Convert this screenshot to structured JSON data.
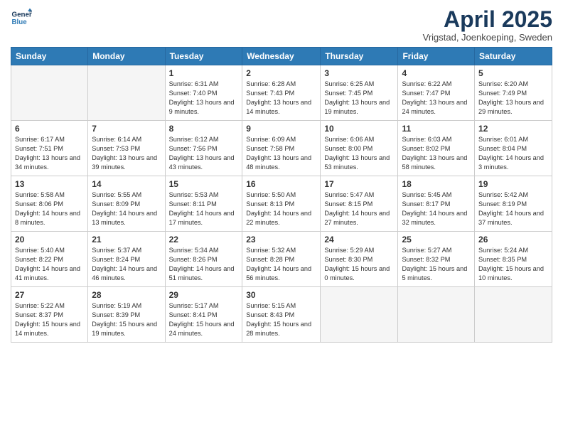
{
  "header": {
    "logo_line1": "General",
    "logo_line2": "Blue",
    "title": "April 2025",
    "location": "Vrigstad, Joenkoeping, Sweden"
  },
  "weekdays": [
    "Sunday",
    "Monday",
    "Tuesday",
    "Wednesday",
    "Thursday",
    "Friday",
    "Saturday"
  ],
  "weeks": [
    [
      {
        "day": "",
        "info": ""
      },
      {
        "day": "",
        "info": ""
      },
      {
        "day": "1",
        "info": "Sunrise: 6:31 AM\nSunset: 7:40 PM\nDaylight: 13 hours and 9 minutes."
      },
      {
        "day": "2",
        "info": "Sunrise: 6:28 AM\nSunset: 7:43 PM\nDaylight: 13 hours and 14 minutes."
      },
      {
        "day": "3",
        "info": "Sunrise: 6:25 AM\nSunset: 7:45 PM\nDaylight: 13 hours and 19 minutes."
      },
      {
        "day": "4",
        "info": "Sunrise: 6:22 AM\nSunset: 7:47 PM\nDaylight: 13 hours and 24 minutes."
      },
      {
        "day": "5",
        "info": "Sunrise: 6:20 AM\nSunset: 7:49 PM\nDaylight: 13 hours and 29 minutes."
      }
    ],
    [
      {
        "day": "6",
        "info": "Sunrise: 6:17 AM\nSunset: 7:51 PM\nDaylight: 13 hours and 34 minutes."
      },
      {
        "day": "7",
        "info": "Sunrise: 6:14 AM\nSunset: 7:53 PM\nDaylight: 13 hours and 39 minutes."
      },
      {
        "day": "8",
        "info": "Sunrise: 6:12 AM\nSunset: 7:56 PM\nDaylight: 13 hours and 43 minutes."
      },
      {
        "day": "9",
        "info": "Sunrise: 6:09 AM\nSunset: 7:58 PM\nDaylight: 13 hours and 48 minutes."
      },
      {
        "day": "10",
        "info": "Sunrise: 6:06 AM\nSunset: 8:00 PM\nDaylight: 13 hours and 53 minutes."
      },
      {
        "day": "11",
        "info": "Sunrise: 6:03 AM\nSunset: 8:02 PM\nDaylight: 13 hours and 58 minutes."
      },
      {
        "day": "12",
        "info": "Sunrise: 6:01 AM\nSunset: 8:04 PM\nDaylight: 14 hours and 3 minutes."
      }
    ],
    [
      {
        "day": "13",
        "info": "Sunrise: 5:58 AM\nSunset: 8:06 PM\nDaylight: 14 hours and 8 minutes."
      },
      {
        "day": "14",
        "info": "Sunrise: 5:55 AM\nSunset: 8:09 PM\nDaylight: 14 hours and 13 minutes."
      },
      {
        "day": "15",
        "info": "Sunrise: 5:53 AM\nSunset: 8:11 PM\nDaylight: 14 hours and 17 minutes."
      },
      {
        "day": "16",
        "info": "Sunrise: 5:50 AM\nSunset: 8:13 PM\nDaylight: 14 hours and 22 minutes."
      },
      {
        "day": "17",
        "info": "Sunrise: 5:47 AM\nSunset: 8:15 PM\nDaylight: 14 hours and 27 minutes."
      },
      {
        "day": "18",
        "info": "Sunrise: 5:45 AM\nSunset: 8:17 PM\nDaylight: 14 hours and 32 minutes."
      },
      {
        "day": "19",
        "info": "Sunrise: 5:42 AM\nSunset: 8:19 PM\nDaylight: 14 hours and 37 minutes."
      }
    ],
    [
      {
        "day": "20",
        "info": "Sunrise: 5:40 AM\nSunset: 8:22 PM\nDaylight: 14 hours and 41 minutes."
      },
      {
        "day": "21",
        "info": "Sunrise: 5:37 AM\nSunset: 8:24 PM\nDaylight: 14 hours and 46 minutes."
      },
      {
        "day": "22",
        "info": "Sunrise: 5:34 AM\nSunset: 8:26 PM\nDaylight: 14 hours and 51 minutes."
      },
      {
        "day": "23",
        "info": "Sunrise: 5:32 AM\nSunset: 8:28 PM\nDaylight: 14 hours and 56 minutes."
      },
      {
        "day": "24",
        "info": "Sunrise: 5:29 AM\nSunset: 8:30 PM\nDaylight: 15 hours and 0 minutes."
      },
      {
        "day": "25",
        "info": "Sunrise: 5:27 AM\nSunset: 8:32 PM\nDaylight: 15 hours and 5 minutes."
      },
      {
        "day": "26",
        "info": "Sunrise: 5:24 AM\nSunset: 8:35 PM\nDaylight: 15 hours and 10 minutes."
      }
    ],
    [
      {
        "day": "27",
        "info": "Sunrise: 5:22 AM\nSunset: 8:37 PM\nDaylight: 15 hours and 14 minutes."
      },
      {
        "day": "28",
        "info": "Sunrise: 5:19 AM\nSunset: 8:39 PM\nDaylight: 15 hours and 19 minutes."
      },
      {
        "day": "29",
        "info": "Sunrise: 5:17 AM\nSunset: 8:41 PM\nDaylight: 15 hours and 24 minutes."
      },
      {
        "day": "30",
        "info": "Sunrise: 5:15 AM\nSunset: 8:43 PM\nDaylight: 15 hours and 28 minutes."
      },
      {
        "day": "",
        "info": ""
      },
      {
        "day": "",
        "info": ""
      },
      {
        "day": "",
        "info": ""
      }
    ]
  ]
}
